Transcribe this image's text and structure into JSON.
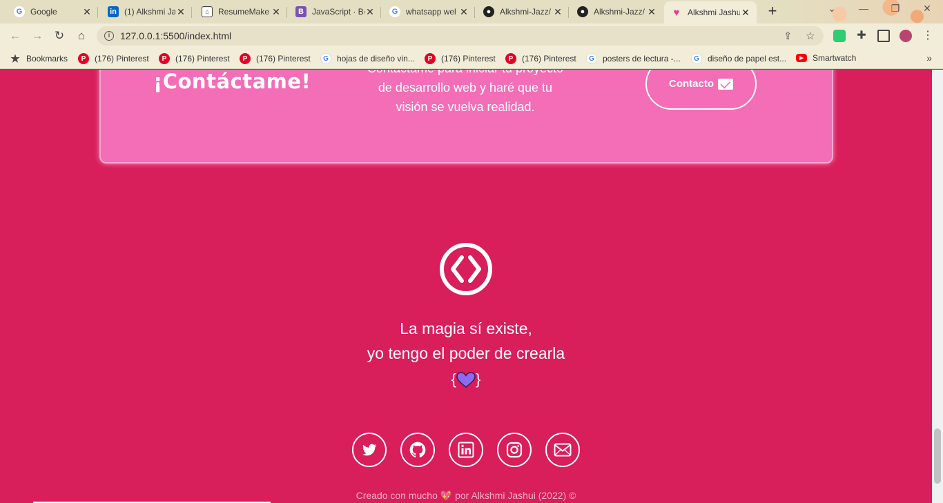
{
  "browser": {
    "tabs": [
      {
        "title": "Google",
        "favicon": "google-icon",
        "active": false
      },
      {
        "title": "(1) Alkshmi Ja",
        "favicon": "linkedin-icon",
        "active": false
      },
      {
        "title": "ResumeMake",
        "favicon": "resumemaker-icon",
        "active": false
      },
      {
        "title": "JavaScript · Bo",
        "favicon": "bootstrap-icon",
        "active": false
      },
      {
        "title": "whatsapp wel",
        "favicon": "google-icon",
        "active": false
      },
      {
        "title": "Alkshmi-Jazz/",
        "favicon": "github-icon",
        "active": false
      },
      {
        "title": "Alkshmi-Jazz/",
        "favicon": "github-icon",
        "active": false
      },
      {
        "title": "Alkshmi Jashu",
        "favicon": "heart-icon",
        "active": true
      }
    ],
    "close_glyph": "✕",
    "new_tab_glyph": "+",
    "url": "127.0.0.1:5500/index.html",
    "bookmarks": [
      {
        "label": "Bookmarks",
        "icon": "star-icon"
      },
      {
        "label": "(176) Pinterest",
        "icon": "pinterest-icon"
      },
      {
        "label": "(176) Pinterest",
        "icon": "pinterest-icon"
      },
      {
        "label": "(176) Pinterest",
        "icon": "pinterest-icon"
      },
      {
        "label": "hojas de diseño vin...",
        "icon": "google-icon"
      },
      {
        "label": "(176) Pinterest",
        "icon": "pinterest-icon"
      },
      {
        "label": "(176) Pinterest",
        "icon": "pinterest-icon"
      },
      {
        "label": "posters de lectura -...",
        "icon": "google-icon"
      },
      {
        "label": "diseño de papel est...",
        "icon": "google-icon"
      },
      {
        "label": "Smartwatch",
        "icon": "youtube-icon"
      }
    ]
  },
  "page": {
    "cta": {
      "title": "¡Contáctame!",
      "text_line1": "Contáctame para iniciar tu proyecto",
      "text_line2": "de desarrollo web y haré que tu",
      "text_line3": "visión se vuelva realidad.",
      "button_label": "Contacto"
    },
    "tagline_line1": "La magia sí existe,",
    "tagline_line2": "yo tengo el poder de crearla",
    "brace_open": "{",
    "brace_close": "}",
    "social": [
      "twitter-icon",
      "github-icon",
      "linkedin-icon",
      "instagram-icon",
      "mail-icon"
    ],
    "credit_before": "Creado con mucho",
    "credit_after": "por Alkshmi Jashui (2022) ©"
  },
  "colors": {
    "page_bg": "#d81e5b",
    "cta_bg": "#f46db7",
    "chrome_bg": "#f1edd9",
    "heart_purple": "#8b6cf0"
  }
}
